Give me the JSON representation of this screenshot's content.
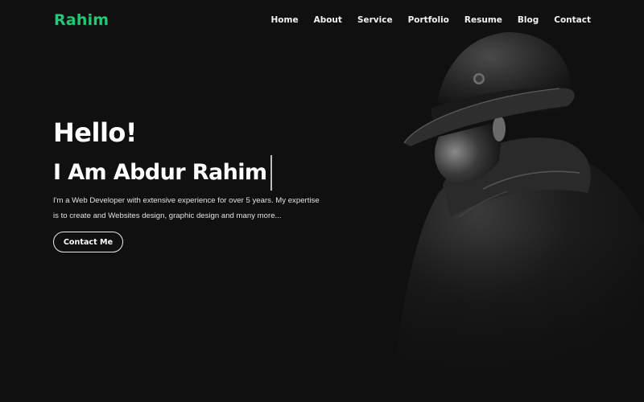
{
  "header": {
    "logo": "Rahim",
    "nav": [
      "Home",
      "About",
      "Service",
      "Portfolio",
      "Resume",
      "Blog",
      "Contact"
    ]
  },
  "hero": {
    "greeting": "Hello!",
    "name_line": "I Am Abdur Rahim",
    "description": "I'm a Web Developer with extensive experience for over 5 years. My expertise is to create and Websites design, graphic design and many more...",
    "cta_label": "Contact Me",
    "image_alt": "man-in-hat-portrait"
  },
  "colors": {
    "background": "#101010",
    "accent": "#22c876",
    "text": "#ffffff"
  }
}
